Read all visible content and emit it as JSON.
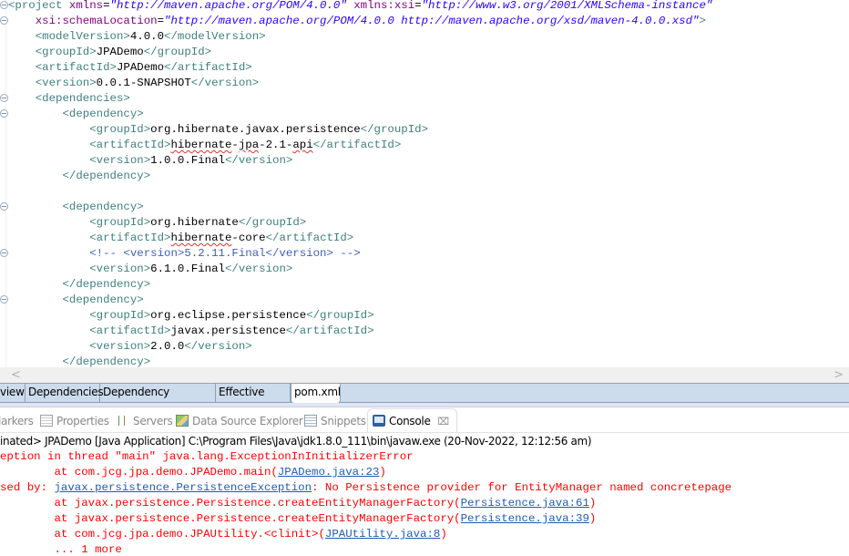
{
  "editor": {
    "lines": [
      {
        "indent": "",
        "fold": true,
        "parts": [
          [
            "tag",
            "<project "
          ],
          [
            "attr",
            "xmlns"
          ],
          [
            "txt",
            "="
          ],
          [
            "val",
            "\"http://maven.apache.org/POM/4.0.0\""
          ],
          [
            "txt",
            " "
          ],
          [
            "attr",
            "xmlns:xsi"
          ],
          [
            "txt",
            "="
          ],
          [
            "val",
            "\"http://www.w3.org/2001/XMLSchema-instance\""
          ]
        ]
      },
      {
        "indent": "    ",
        "fold": true,
        "parts": [
          [
            "attr",
            "xsi:schemaLocation"
          ],
          [
            "txt",
            "="
          ],
          [
            "val",
            "\"http://maven.apache.org/POM/4.0.0 http://maven.apache.org/xsd/maven-4.0.0.xsd\""
          ],
          [
            "tag",
            ">"
          ]
        ]
      },
      {
        "indent": "    ",
        "parts": [
          [
            "tag",
            "<modelVersion>"
          ],
          [
            "txt",
            "4.0.0"
          ],
          [
            "tag",
            "</modelVersion>"
          ]
        ]
      },
      {
        "indent": "    ",
        "parts": [
          [
            "tag",
            "<groupId>"
          ],
          [
            "txt",
            "JPADemo"
          ],
          [
            "tag",
            "</groupId>"
          ]
        ]
      },
      {
        "indent": "    ",
        "parts": [
          [
            "tag",
            "<artifactId>"
          ],
          [
            "txt",
            "JPADemo"
          ],
          [
            "tag",
            "</artifactId>"
          ]
        ]
      },
      {
        "indent": "    ",
        "parts": [
          [
            "tag",
            "<version>"
          ],
          [
            "txt",
            "0.0.1-SNAPSHOT"
          ],
          [
            "tag",
            "</version>"
          ]
        ]
      },
      {
        "indent": "    ",
        "fold": true,
        "parts": [
          [
            "tag",
            "<dependencies>"
          ]
        ]
      },
      {
        "indent": "        ",
        "fold": true,
        "parts": [
          [
            "tag",
            "<dependency>"
          ]
        ]
      },
      {
        "indent": "            ",
        "parts": [
          [
            "tag",
            "<groupId>"
          ],
          [
            "txt",
            "org.hibernate.javax.persistence"
          ],
          [
            "tag",
            "</groupId>"
          ]
        ]
      },
      {
        "indent": "            ",
        "parts": [
          [
            "tag",
            "<artifactId>"
          ],
          [
            "squig",
            "hibernate"
          ],
          [
            "txt",
            "-"
          ],
          [
            "squig",
            "jpa"
          ],
          [
            "txt",
            "-2.1-"
          ],
          [
            "squig",
            "api"
          ],
          [
            "tag",
            "</artifactId>"
          ]
        ]
      },
      {
        "indent": "            ",
        "parts": [
          [
            "tag",
            "<version>"
          ],
          [
            "txt",
            "1.0.0.Final"
          ],
          [
            "tag",
            "</version>"
          ]
        ]
      },
      {
        "indent": "        ",
        "parts": [
          [
            "tag",
            "</dependency>"
          ]
        ]
      },
      {
        "indent": "",
        "parts": []
      },
      {
        "indent": "        ",
        "fold": true,
        "parts": [
          [
            "tag",
            "<dependency>"
          ]
        ]
      },
      {
        "indent": "            ",
        "parts": [
          [
            "tag",
            "<groupId>"
          ],
          [
            "txt",
            "org.hibernate"
          ],
          [
            "tag",
            "</groupId>"
          ]
        ]
      },
      {
        "indent": "            ",
        "parts": [
          [
            "tag",
            "<artifactId>"
          ],
          [
            "squig",
            "hibernate"
          ],
          [
            "txt",
            "-core"
          ],
          [
            "tag",
            "</artifactId>"
          ]
        ]
      },
      {
        "indent": "            ",
        "fold": true,
        "parts": [
          [
            "cmt",
            "<!-- <version>5.2.11.Final</version> -->"
          ]
        ]
      },
      {
        "indent": "            ",
        "parts": [
          [
            "tag",
            "<version>"
          ],
          [
            "txt",
            "6.1.0.Final"
          ],
          [
            "tag",
            "</version>"
          ]
        ]
      },
      {
        "indent": "        ",
        "parts": [
          [
            "tag",
            "</dependency>"
          ]
        ]
      },
      {
        "indent": "        ",
        "fold": true,
        "parts": [
          [
            "tag",
            "<dependency>"
          ]
        ]
      },
      {
        "indent": "            ",
        "parts": [
          [
            "tag",
            "<groupId>"
          ],
          [
            "txt",
            "org.eclipse.persistence"
          ],
          [
            "tag",
            "</groupId>"
          ]
        ]
      },
      {
        "indent": "            ",
        "parts": [
          [
            "tag",
            "<artifactId>"
          ],
          [
            "txt",
            "javax.persistence"
          ],
          [
            "tag",
            "</artifactId>"
          ]
        ]
      },
      {
        "indent": "            ",
        "parts": [
          [
            "tag",
            "<version>"
          ],
          [
            "txt",
            "2.0.0"
          ],
          [
            "tag",
            "</version>"
          ]
        ]
      },
      {
        "indent": "        ",
        "parts": [
          [
            "tag",
            "</dependency>"
          ]
        ]
      }
    ]
  },
  "scrollbar": {
    "left_arrow": "<",
    "right_arrow": ">"
  },
  "page_tabs": [
    {
      "label": "view",
      "active": false
    },
    {
      "label": "Dependencies",
      "active": false
    },
    {
      "label": "Dependency Hierarchy",
      "active": false
    },
    {
      "label": "Effective POM",
      "active": false
    },
    {
      "label": "pom.xml",
      "active": true
    }
  ],
  "view_tabs": [
    {
      "label": "larkers",
      "icon": "markers-icon"
    },
    {
      "label": "Properties",
      "icon": "properties-icon"
    },
    {
      "label": "Servers",
      "icon": "servers-icon"
    },
    {
      "label": "Data Source Explorer",
      "icon": "data-source-explorer-icon"
    },
    {
      "label": "Snippets",
      "icon": "snippets-icon"
    },
    {
      "label": "Console",
      "icon": "console-icon",
      "active": true,
      "close": "⌧"
    }
  ],
  "console": {
    "header": "inated> JPADemo [Java Application] C:\\Program Files\\Java\\jdk1.8.0_111\\bin\\javaw.exe (20-Nov-2022, 12:12:56 am)",
    "lines": [
      [
        [
          "t",
          "eption in thread \"main\" java.lang.ExceptionInInitializerError"
        ]
      ],
      [
        [
          "t",
          "        at com.jcg.jpa.demo.JPADemo.main("
        ],
        [
          "l",
          "JPADemo.java:23"
        ],
        [
          "t",
          ")"
        ]
      ],
      [
        [
          "t",
          "sed by: "
        ],
        [
          "l",
          "javax.persistence.PersistenceException"
        ],
        [
          "t",
          ": No Persistence provider for EntityManager named concretepage"
        ]
      ],
      [
        [
          "t",
          "        at javax.persistence.Persistence.createEntityManagerFactory("
        ],
        [
          "l",
          "Persistence.java:61"
        ],
        [
          "t",
          ")"
        ]
      ],
      [
        [
          "t",
          "        at javax.persistence.Persistence.createEntityManagerFactory("
        ],
        [
          "l",
          "Persistence.java:39"
        ],
        [
          "t",
          ")"
        ]
      ],
      [
        [
          "t",
          "        at com.jcg.jpa.demo.JPAUtility.<clinit>("
        ],
        [
          "l",
          "JPAUtility.java:8"
        ],
        [
          "t",
          ")"
        ]
      ],
      [
        [
          "t",
          "        ... 1 more"
        ]
      ]
    ]
  },
  "colors": {
    "tag": "#3f7f7f",
    "attr": "#7f007f",
    "value": "#2a00ff",
    "comment": "#3f5fbf",
    "error": "#ff0000",
    "link": "#1e5bb8",
    "tab_bar": "#cddcec"
  }
}
